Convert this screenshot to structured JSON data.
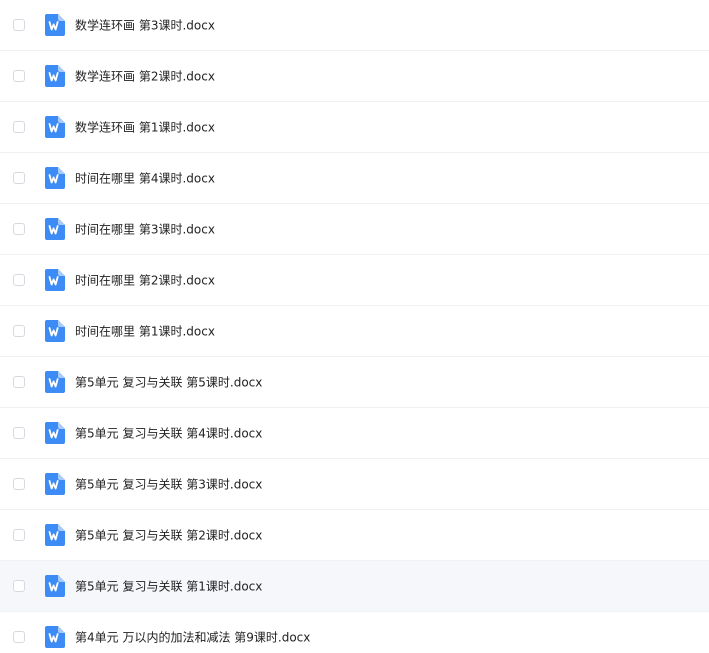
{
  "file_list": {
    "items": [
      {
        "name": "数学连环画 第3课时.docx",
        "icon": "word-docx-icon"
      },
      {
        "name": "数学连环画 第2课时.docx",
        "icon": "word-docx-icon"
      },
      {
        "name": "数学连环画 第1课时.docx",
        "icon": "word-docx-icon"
      },
      {
        "name": "时间在哪里 第4课时.docx",
        "icon": "word-docx-icon"
      },
      {
        "name": "时间在哪里 第3课时.docx",
        "icon": "word-docx-icon"
      },
      {
        "name": "时间在哪里 第2课时.docx",
        "icon": "word-docx-icon"
      },
      {
        "name": "时间在哪里 第1课时.docx",
        "icon": "word-docx-icon"
      },
      {
        "name": "第5单元 复习与关联 第5课时.docx",
        "icon": "word-docx-icon"
      },
      {
        "name": "第5单元 复习与关联 第4课时.docx",
        "icon": "word-docx-icon"
      },
      {
        "name": "第5单元 复习与关联 第3课时.docx",
        "icon": "word-docx-icon"
      },
      {
        "name": "第5单元 复习与关联 第2课时.docx",
        "icon": "word-docx-icon"
      },
      {
        "name": "第5单元 复习与关联 第1课时.docx",
        "icon": "word-docx-icon",
        "hovered": true
      },
      {
        "name": "第4单元 万以内的加法和减法 第9课时.docx",
        "icon": "word-docx-icon"
      }
    ]
  },
  "colors": {
    "icon_blue": "#3d8bf5",
    "icon_fold": "#a9cbfb",
    "row_hover_bg": "#f6f7fb",
    "divider": "#f0f1f4",
    "text": "#222222"
  }
}
